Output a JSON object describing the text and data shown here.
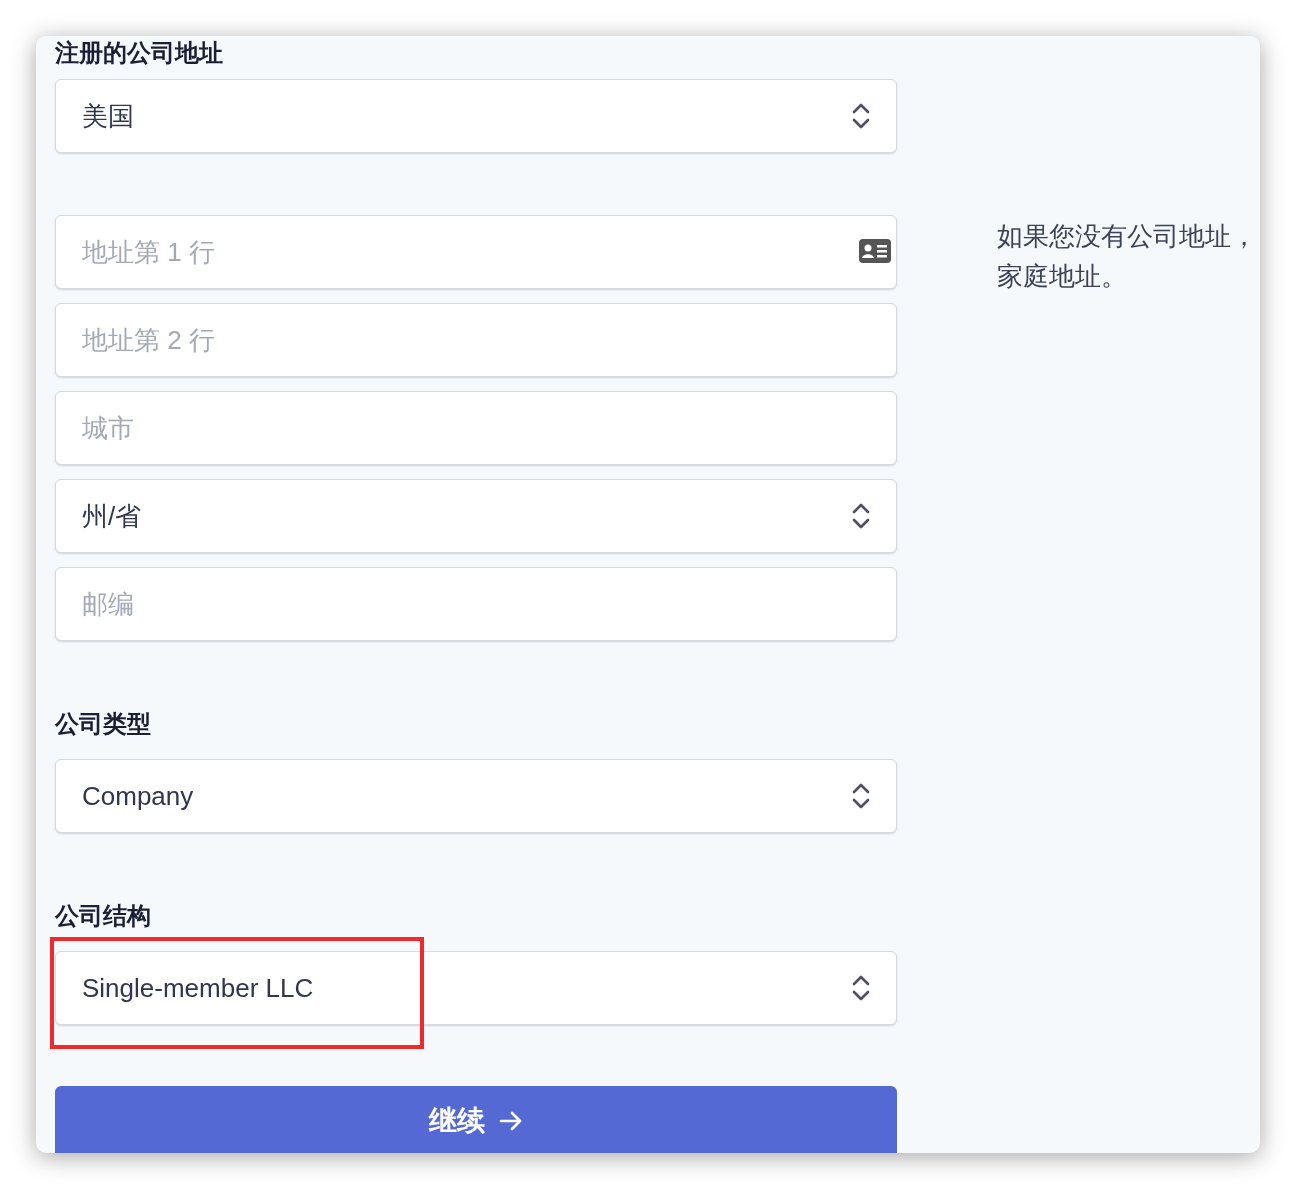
{
  "address_section": {
    "label": "注册的公司地址",
    "country": {
      "kind": "select",
      "value": "美国"
    },
    "fields": [
      {
        "kind": "input",
        "placeholder": "地址第 1 行",
        "contact_icon": true
      },
      {
        "kind": "input",
        "placeholder": "地址第 2 行",
        "contact_icon": false
      },
      {
        "kind": "input",
        "placeholder": "城市",
        "contact_icon": false
      },
      {
        "kind": "select",
        "value": "州/省"
      },
      {
        "kind": "input",
        "placeholder": "邮编",
        "contact_icon": false
      }
    ]
  },
  "hint": {
    "lines": [
      "如果您没有公司地址，",
      "家庭地址。"
    ]
  },
  "company_type": {
    "label": "公司类型",
    "select": {
      "kind": "select",
      "value": "Company"
    }
  },
  "company_structure": {
    "label": "公司结构",
    "select": {
      "kind": "select",
      "value": "Single-member LLC"
    },
    "highlighted": true
  },
  "continue_button": {
    "label": "继续"
  }
}
